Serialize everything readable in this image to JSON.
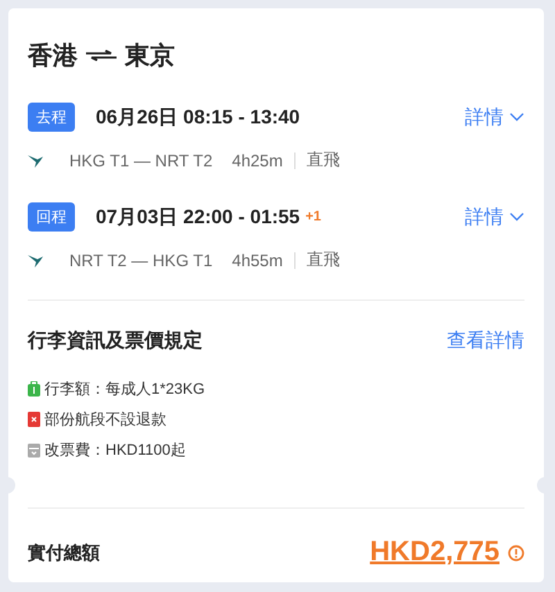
{
  "title": {
    "origin": "香港",
    "destination": "東京"
  },
  "segments": [
    {
      "tag": "去程",
      "datetime": "06月26日 08:15 - 13:40",
      "route": "HKG T1 — NRT T2",
      "duration": "4h25m",
      "stops": "直飛",
      "details": "詳情"
    },
    {
      "tag": "回程",
      "datetime": "07月03日 22:00 - 01:55",
      "day_offset": "+1",
      "route": "NRT T2 — HKG T1",
      "duration": "4h55m",
      "stops": "直飛",
      "details": "詳情"
    }
  ],
  "policy": {
    "heading": "行李資訊及票價規定",
    "link": "查看詳情",
    "rules": [
      {
        "kind": "baggage",
        "text": "行李額：每成人1*23KG"
      },
      {
        "kind": "refund",
        "text": "部份航段不設退款"
      },
      {
        "kind": "change",
        "text": "改票費：HKD1100起"
      }
    ]
  },
  "total": {
    "label": "實付總額",
    "amount": "HKD2,775"
  }
}
